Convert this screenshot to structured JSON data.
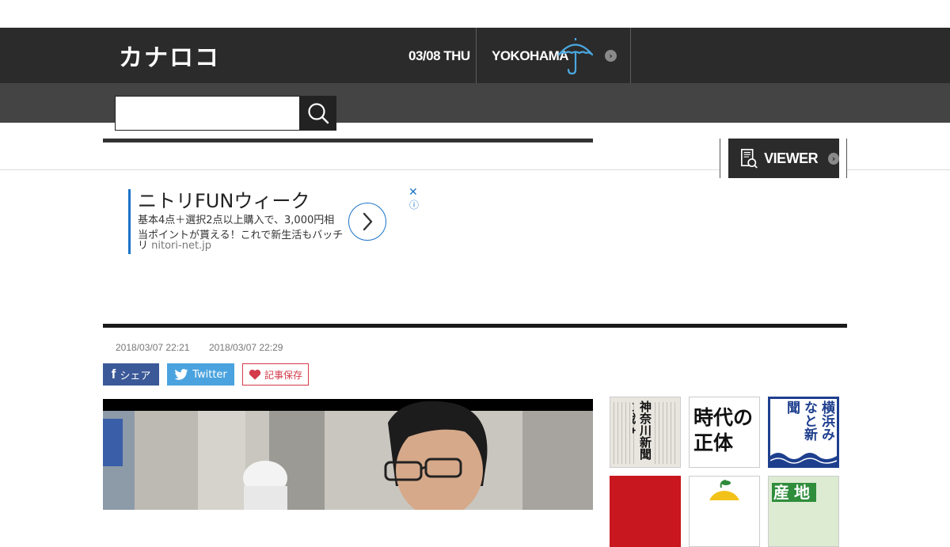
{
  "header": {
    "logo_text": "カナロコ",
    "date": "03/08 THU",
    "city": "YOKOHAMA",
    "weather_icon": "umbrella-icon",
    "weather_arrow": "›",
    "accent_color": "#4aa8e0"
  },
  "search": {
    "placeholder": "",
    "value": ""
  },
  "viewer": {
    "label": "VIEWER",
    "arrow": "›"
  },
  "ad": {
    "title": "ニトリFUNウィーク",
    "lines": [
      "基本4点＋選択2点以上購入で、3,000円相",
      "当ポイントが貰える！これで新生活もバッチ"
    ],
    "tail": "リ",
    "domain": "nitori-net.jp",
    "close": "✕",
    "info": "ⓘ"
  },
  "article": {
    "published": "2018/03/07 22:21",
    "updated": "2018/03/07 22:29"
  },
  "share": {
    "facebook_icon": "f",
    "facebook_label": "シェア",
    "twitter_label": "Twitter",
    "save_label": "記事保存"
  },
  "sidebar": {
    "thumbs": [
      {
        "text": "神奈川新聞と戦争"
      },
      {
        "text": "時代の正体"
      },
      {
        "text": "横浜みなと新聞"
      },
      {
        "text": "産地"
      }
    ]
  }
}
